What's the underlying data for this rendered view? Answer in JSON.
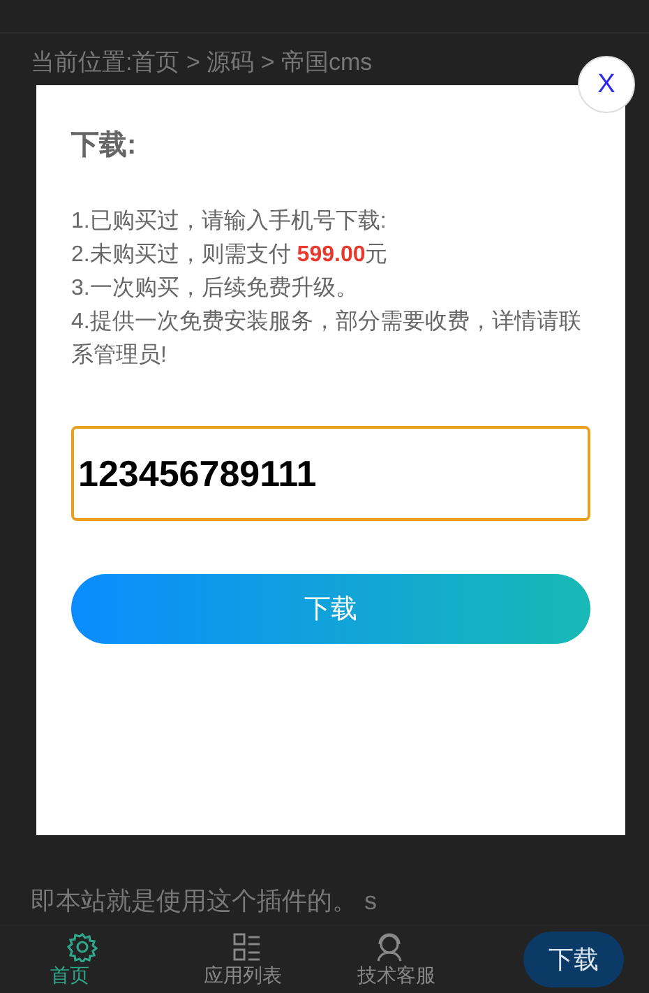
{
  "breadcrumb": "当前位置:首页 > 源码 > 帝国cms",
  "article_line": "即本站就是使用这个插件的。 s",
  "bottom_nav": {
    "items": [
      {
        "label": "首页",
        "kind": "gear",
        "selected": true
      },
      {
        "label": "应用列表",
        "kind": "list",
        "selected": false
      },
      {
        "label": "技术客服",
        "kind": "support",
        "selected": false
      }
    ],
    "download_button": "下载"
  },
  "dialog": {
    "close": "X",
    "title": "下载:",
    "lines": [
      "1.已购买过，请输入手机号下载:",
      "2.未购买过，则需支付 **599.00**元",
      "3.一次购买，后续免费升级。",
      "4.提供一次免费安装服务，部分需要收费，详情请联系管理员!"
    ],
    "phone_field": {
      "value": "123456789111"
    },
    "submit_button": "下载"
  }
}
